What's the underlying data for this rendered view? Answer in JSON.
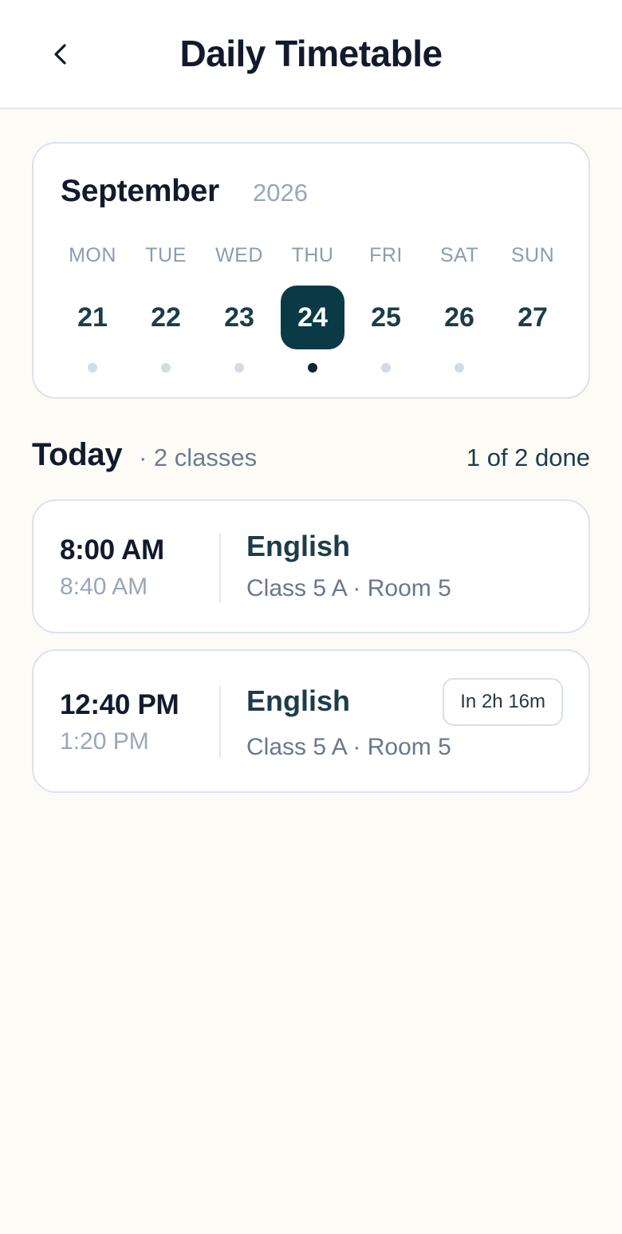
{
  "header": {
    "title": "Daily Timetable",
    "back_icon": "chevron-left-icon"
  },
  "calendar": {
    "month": "September",
    "year": "2026",
    "days": [
      {
        "dow": "MON",
        "num": "21",
        "selected": false,
        "dot": "muted"
      },
      {
        "dow": "TUE",
        "num": "22",
        "selected": false,
        "dot": "muted"
      },
      {
        "dow": "WED",
        "num": "23",
        "selected": false,
        "dot": "muted"
      },
      {
        "dow": "THU",
        "num": "24",
        "selected": true,
        "dot": "active"
      },
      {
        "dow": "FRI",
        "num": "25",
        "selected": false,
        "dot": "muted"
      },
      {
        "dow": "SAT",
        "num": "26",
        "selected": false,
        "dot": "muted"
      },
      {
        "dow": "SUN",
        "num": "27",
        "selected": false,
        "dot": "none"
      }
    ],
    "selected_color": "#0a3a45"
  },
  "today": {
    "label": "Today",
    "count": "· 2 classes",
    "progress": "1 of 2 done"
  },
  "classes": [
    {
      "start": "8:00 AM",
      "end": "8:40 AM",
      "subject": "English",
      "details": "Class 5 A · Room 5",
      "badge": ""
    },
    {
      "start": "12:40 PM",
      "end": "1:20 PM",
      "subject": "English",
      "details": "Class 5 A · Room 5",
      "badge": "In 2h 16m"
    }
  ]
}
